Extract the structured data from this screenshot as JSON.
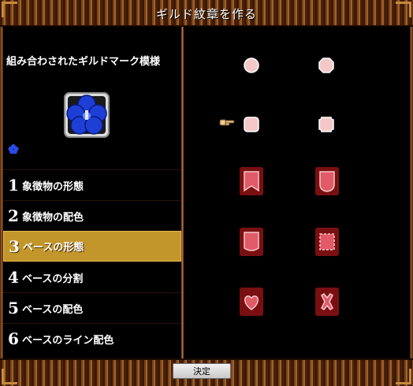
{
  "window": {
    "title": "ギルド紋章を作る"
  },
  "preview": {
    "label": "組み合わされたギルドマーク模様",
    "emblem_icon": "blue-flower-emblem"
  },
  "menu": {
    "items": [
      {
        "num": "1",
        "label": "象徴物の形態",
        "selected": false
      },
      {
        "num": "2",
        "label": "象徴物の配色",
        "selected": false
      },
      {
        "num": "3",
        "label": "ベースの形態",
        "selected": true
      },
      {
        "num": "4",
        "label": "ベースの分割",
        "selected": false
      },
      {
        "num": "5",
        "label": "ベースの配色",
        "selected": false
      },
      {
        "num": "6",
        "label": "ベースのライン配色",
        "selected": false
      }
    ]
  },
  "options": {
    "shapes": [
      "circle-shape-icon",
      "octagon-shape-icon",
      "rounded-square-shape-icon",
      "notched-square-shape-icon",
      "banner-notch-shape-icon",
      "shield-shape-icon",
      "pennant-shape-icon",
      "scalloped-square-shape-icon",
      "heart-shape-icon",
      "cross-x-shape-icon"
    ],
    "cursor_icon": "pointing-hand-icon"
  },
  "footer": {
    "confirm_label": "決定"
  },
  "colors": {
    "selected_bg": "#c2962a",
    "shape_fill": "#f4c8c8",
    "shape_bg": "#7a0f12"
  }
}
